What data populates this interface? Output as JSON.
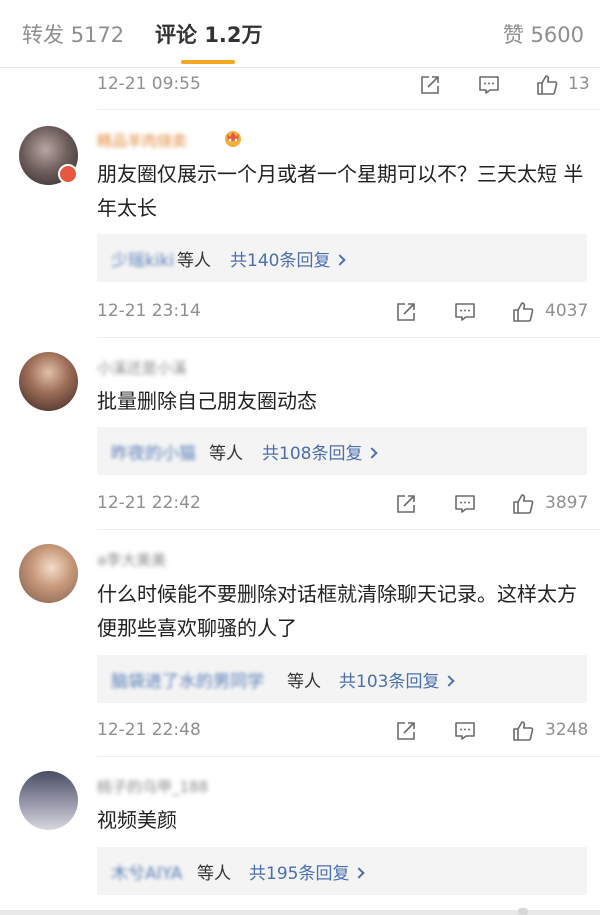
{
  "tabs": {
    "repost_label": "转发",
    "repost_count": "5172",
    "comment_label": "评论",
    "comment_count": "1.2万",
    "like_label": "赞",
    "like_count": "5600"
  },
  "top_meta": {
    "time": "12-21 09:55",
    "like_count": "13"
  },
  "comments": [
    {
      "username": "精品羊肉烧卖",
      "text": "朋友圈仅展示一个月或者一个星期可以不？三天太短 半年太长",
      "reply_names": "少瑶kiki",
      "reply_suffix": "等人",
      "reply_link": "共140条回复",
      "time": "12-21 23:14",
      "like_count": "4037"
    },
    {
      "username": "小溪还是小溪",
      "text": "批量删除自己朋友圈动态",
      "reply_names": "昨夜的小猫",
      "reply_suffix": "等人",
      "reply_link": "共108条回复",
      "time": "12-21 22:42",
      "like_count": "3897"
    },
    {
      "username": "a李大美美",
      "text": "什么时候能不要删除对话框就清除聊天记录。这样太方便那些喜欢聊骚的人了",
      "reply_names": "脑袋进了水的男同学",
      "reply_suffix": "等人",
      "reply_link": "共103条回复",
      "time": "12-21 22:48",
      "like_count": "3248"
    },
    {
      "username": "桃子的乌甲_188",
      "text": "视频美颜",
      "reply_names": "木兮AIYA",
      "reply_suffix": "等人",
      "reply_link": "共195条回复"
    }
  ],
  "colors": {
    "accent_underline": "#f5a623",
    "link_blue": "#4a6fb0",
    "vip_username": "#e0883a"
  },
  "icons": [
    "share-icon",
    "comment-icon",
    "like-icon",
    "crown-icon",
    "chevron-right-icon"
  ]
}
